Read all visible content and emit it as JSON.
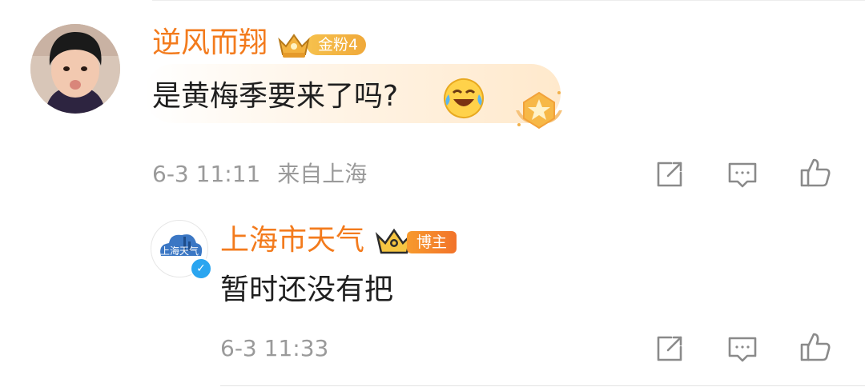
{
  "comment": {
    "username": "逆风而翔",
    "fan_badge": "金粉4",
    "text": "是黄梅季要来了吗?",
    "emoji": "laugh-cry-emoji",
    "time": "6-3 11:11",
    "location": "来自上海"
  },
  "reply": {
    "username": "上海市天气",
    "host_badge": "博主",
    "avatar_text": "上海天气",
    "text": "暂时还没有把",
    "time": "6-3 11:33"
  },
  "colors": {
    "username": "#f37b1d",
    "text": "#1f1f1f",
    "meta": "#9a9a9a",
    "verify": "#2aa5f0"
  },
  "icons": [
    "share-icon",
    "comment-icon",
    "like-icon"
  ]
}
